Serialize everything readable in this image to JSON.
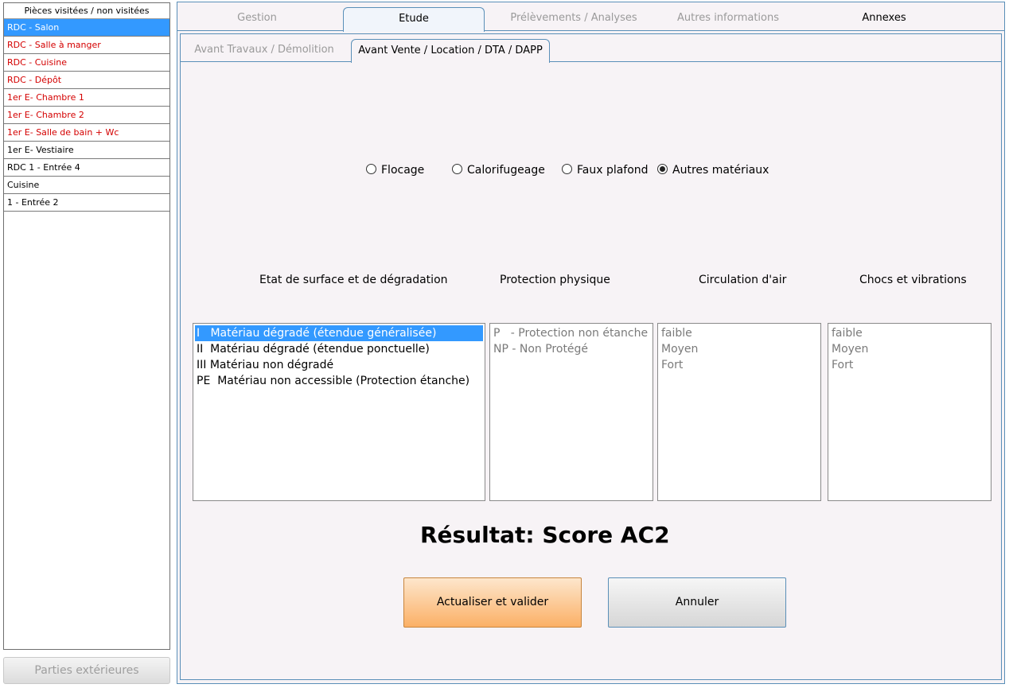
{
  "rooms": {
    "header": "Pièces visitées / non visitées",
    "items": [
      {
        "label": "RDC - Salon",
        "state": "selected"
      },
      {
        "label": "RDC - Salle à manger",
        "state": "unvisited"
      },
      {
        "label": "RDC - Cuisine",
        "state": "unvisited"
      },
      {
        "label": "RDC - Dépôt",
        "state": "unvisited"
      },
      {
        "label": "1er E- Chambre 1",
        "state": "unvisited"
      },
      {
        "label": "1er E- Chambre 2",
        "state": "unvisited"
      },
      {
        "label": "1er E- Salle de bain + Wc",
        "state": "unvisited"
      },
      {
        "label": "1er E- Vestiaire",
        "state": "visited"
      },
      {
        "label": "RDC 1 - Entrée 4",
        "state": "visited"
      },
      {
        "label": "Cuisine",
        "state": "visited"
      },
      {
        "label": "1 - Entrée 2",
        "state": "visited"
      }
    ],
    "exterior_button": "Parties extérieures"
  },
  "top_tabs": [
    "Gestion",
    "Etude",
    "Prélèvements / Analyses",
    "Autres informations",
    "Annexes"
  ],
  "top_tab_active": "Etude",
  "sub_tabs": [
    "Avant Travaux / Démolition",
    "Avant Vente / Location / DTA / DAPP"
  ],
  "sub_tab_active": "Avant Vente / Location / DTA / DAPP",
  "material_options": [
    {
      "label": "Flocage",
      "checked": false
    },
    {
      "label": "Calorifugeage",
      "checked": false
    },
    {
      "label": "Faux plafond",
      "checked": false
    },
    {
      "label": "Autres matériaux",
      "checked": true
    }
  ],
  "columns": {
    "surface": {
      "title": "Etat de surface et de dégradation",
      "items": [
        "I   Matériau dégradé (étendue généralisée)",
        "II  Matériau dégradé (étendue ponctuelle)",
        "III Matériau non dégradé",
        "PE  Matériau non accessible (Protection étanche)"
      ],
      "selected_index": 0
    },
    "protection": {
      "title": "Protection physique",
      "items": [
        "P   - Protection non étanche",
        "NP - Non Protégé"
      ]
    },
    "air": {
      "title": "Circulation d'air",
      "items": [
        "faible",
        "Moyen",
        "Fort"
      ]
    },
    "shocks": {
      "title": "Chocs et vibrations",
      "items": [
        "faible",
        "Moyen",
        "Fort"
      ]
    }
  },
  "result_text": "Résultat: Score AC2",
  "buttons": {
    "validate": "Actualiser et valider",
    "cancel": "Annuler"
  },
  "colors": {
    "selection": "#3399ff",
    "unvisited": "#d40000",
    "accent_border": "#5a8fb8",
    "validate_gradient_end": "#fbb066"
  }
}
